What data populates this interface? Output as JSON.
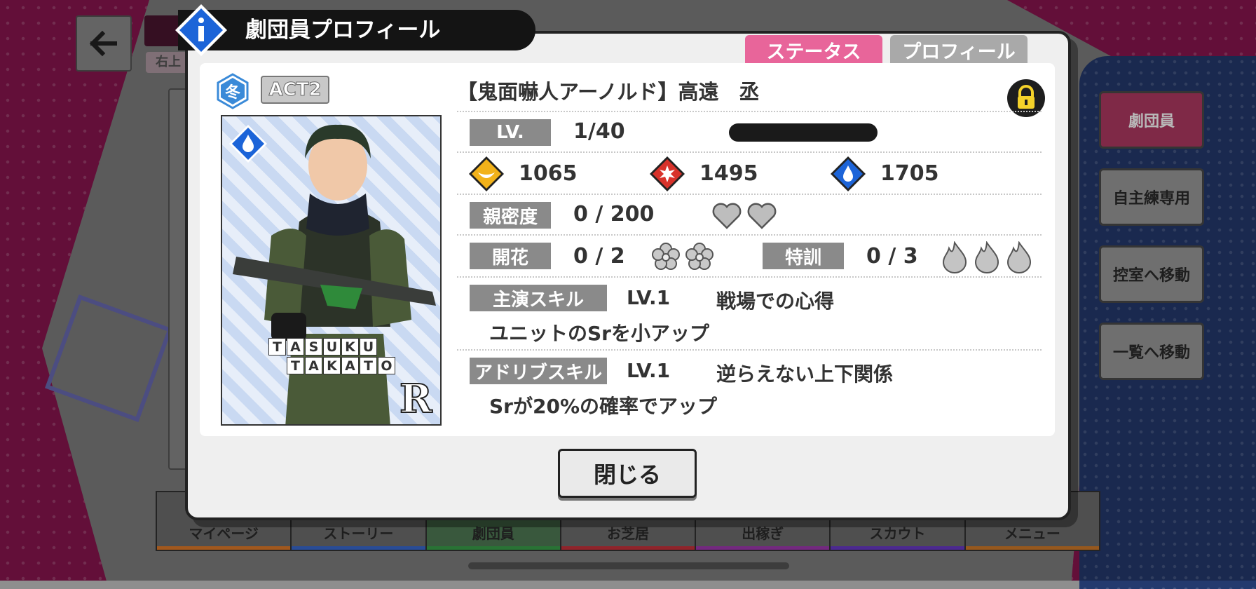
{
  "background": {
    "under_tag": "右上"
  },
  "modal": {
    "title": "劇団員プロフィール",
    "tabs": {
      "status": "ステータス",
      "profile": "プロフィール"
    },
    "season_icon": "冬",
    "act_badge": "ACT2",
    "card_title": "【鬼面嚇人アーノルド】高遠　丞",
    "card_name_line1": [
      "T",
      "A",
      "S",
      "U",
      "K",
      "U"
    ],
    "card_name_line2": [
      "T",
      "A",
      "K",
      "A",
      "T",
      "O"
    ],
    "rarity": "R",
    "level": {
      "label": "LV.",
      "value": "1/40"
    },
    "stats": {
      "stat1": "1065",
      "stat2": "1495",
      "stat3": "1705"
    },
    "intimacy": {
      "label": "親密度",
      "value": "0 / 200",
      "hearts_max": 2
    },
    "bloom": {
      "label": "開花",
      "value": "0 / 2",
      "icons": 2
    },
    "training": {
      "label": "特訓",
      "value": "0 / 3",
      "icons": 3
    },
    "main_skill": {
      "label": "主演スキル",
      "level": "LV.1",
      "name": "戦場での心得",
      "desc": "ユニットのSrを小アップ"
    },
    "adlib_skill": {
      "label": "アドリブスキル",
      "level": "LV.1",
      "name": "逆らえない上下関係",
      "desc": "Srが20%の確率でアップ"
    },
    "close_label": "閉じる"
  },
  "side_buttons": [
    "劇団員",
    "自主練専用",
    "控室へ移動",
    "一覧へ移動"
  ],
  "bottom_nav": [
    {
      "label": "マイページ",
      "color": "#e07a2a"
    },
    {
      "label": "ストーリー",
      "color": "#3a6ad0"
    },
    {
      "label": "劇団員",
      "color": "#3aa04a"
    },
    {
      "label": "お芝居",
      "color": "#c8323c"
    },
    {
      "label": "出稼ぎ",
      "color": "#a03ab0"
    },
    {
      "label": "スカウト",
      "color": "#6a3ac8"
    },
    {
      "label": "メニュー",
      "color": "#d07a2a"
    }
  ],
  "icons": {
    "back": "arrow-left-icon",
    "info": "info-icon",
    "season": "snowflake-season-icon",
    "card_attr": "water-drop-icon",
    "lock": "lock-icon",
    "stat1": "sun-crescent-icon",
    "stat2": "burst-icon",
    "stat3": "water-drop-icon",
    "heart": "heart-icon",
    "bloom": "flower-icon",
    "training": "flame-icon"
  }
}
